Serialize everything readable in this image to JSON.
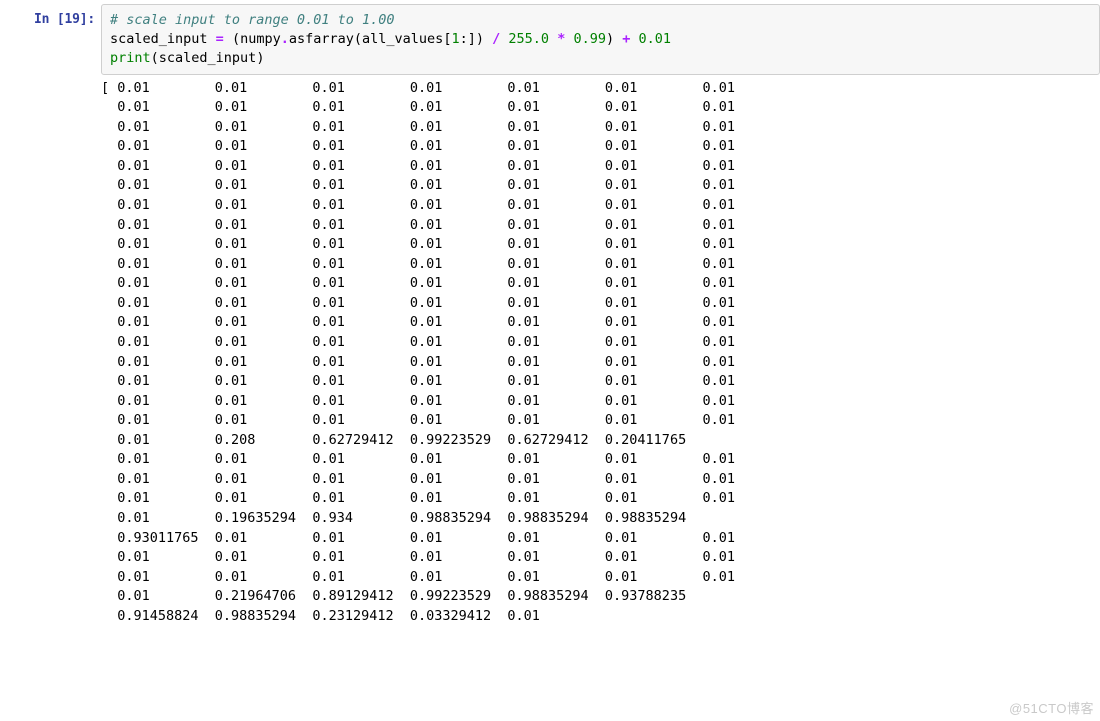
{
  "cell": {
    "execution_count": 19,
    "prompt_prefix": "In [",
    "prompt_suffix": "]:",
    "code": {
      "line1_comment": "# scale input to range 0.01 to 1.00",
      "l2_var": "scaled_input",
      "l2_eq": " = ",
      "l2_p1": "(",
      "l2_numpy": "numpy",
      "l2_dot1": ".",
      "l2_asf": "asfarray",
      "l2_p2": "(",
      "l2_allv": "all_values",
      "l2_br1": "[",
      "l2_one": "1",
      "l2_colon": ":",
      "l2_br2": "]) ",
      "l2_div": "/",
      "l2_sp1": " ",
      "l2_255": "255.0",
      "l2_sp2": " ",
      "l2_mul": "*",
      "l2_sp3": " ",
      "l2_099": "0.99",
      "l2_p3": ") ",
      "l2_plus": "+",
      "l2_sp4": " ",
      "l2_001": "0.01",
      "l3_print": "print",
      "l3_p1": "(",
      "l3_arg": "scaled_input",
      "l3_p2": ")"
    },
    "output_columns": 7,
    "output_col_width": 12,
    "output_opening": "[ ",
    "output_rows": [
      [
        "0.01",
        "0.01",
        "0.01",
        "0.01",
        "0.01",
        "0.01",
        "0.01"
      ],
      [
        "0.01",
        "0.01",
        "0.01",
        "0.01",
        "0.01",
        "0.01",
        "0.01"
      ],
      [
        "0.01",
        "0.01",
        "0.01",
        "0.01",
        "0.01",
        "0.01",
        "0.01"
      ],
      [
        "0.01",
        "0.01",
        "0.01",
        "0.01",
        "0.01",
        "0.01",
        "0.01"
      ],
      [
        "0.01",
        "0.01",
        "0.01",
        "0.01",
        "0.01",
        "0.01",
        "0.01"
      ],
      [
        "0.01",
        "0.01",
        "0.01",
        "0.01",
        "0.01",
        "0.01",
        "0.01"
      ],
      [
        "0.01",
        "0.01",
        "0.01",
        "0.01",
        "0.01",
        "0.01",
        "0.01"
      ],
      [
        "0.01",
        "0.01",
        "0.01",
        "0.01",
        "0.01",
        "0.01",
        "0.01"
      ],
      [
        "0.01",
        "0.01",
        "0.01",
        "0.01",
        "0.01",
        "0.01",
        "0.01"
      ],
      [
        "0.01",
        "0.01",
        "0.01",
        "0.01",
        "0.01",
        "0.01",
        "0.01"
      ],
      [
        "0.01",
        "0.01",
        "0.01",
        "0.01",
        "0.01",
        "0.01",
        "0.01"
      ],
      [
        "0.01",
        "0.01",
        "0.01",
        "0.01",
        "0.01",
        "0.01",
        "0.01"
      ],
      [
        "0.01",
        "0.01",
        "0.01",
        "0.01",
        "0.01",
        "0.01",
        "0.01"
      ],
      [
        "0.01",
        "0.01",
        "0.01",
        "0.01",
        "0.01",
        "0.01",
        "0.01"
      ],
      [
        "0.01",
        "0.01",
        "0.01",
        "0.01",
        "0.01",
        "0.01",
        "0.01"
      ],
      [
        "0.01",
        "0.01",
        "0.01",
        "0.01",
        "0.01",
        "0.01",
        "0.01"
      ],
      [
        "0.01",
        "0.01",
        "0.01",
        "0.01",
        "0.01",
        "0.01",
        "0.01"
      ],
      [
        "0.01",
        "0.01",
        "0.01",
        "0.01",
        "0.01",
        "0.01",
        "0.01"
      ],
      [
        "0.01",
        "0.208",
        "0.62729412",
        "0.99223529",
        "0.62729412",
        "0.20411765"
      ],
      [
        "0.01",
        "0.01",
        "0.01",
        "0.01",
        "0.01",
        "0.01",
        "0.01"
      ],
      [
        "0.01",
        "0.01",
        "0.01",
        "0.01",
        "0.01",
        "0.01",
        "0.01"
      ],
      [
        "0.01",
        "0.01",
        "0.01",
        "0.01",
        "0.01",
        "0.01",
        "0.01"
      ],
      [
        "0.01",
        "0.19635294",
        "0.934",
        "0.98835294",
        "0.98835294",
        "0.98835294"
      ],
      [
        "0.93011765",
        "0.01",
        "0.01",
        "0.01",
        "0.01",
        "0.01",
        "0.01"
      ],
      [
        "0.01",
        "0.01",
        "0.01",
        "0.01",
        "0.01",
        "0.01",
        "0.01"
      ],
      [
        "0.01",
        "0.01",
        "0.01",
        "0.01",
        "0.01",
        "0.01",
        "0.01"
      ],
      [
        "0.01",
        "0.21964706",
        "0.89129412",
        "0.99223529",
        "0.98835294",
        "0.93788235"
      ],
      [
        "0.91458824",
        "0.98835294",
        "0.23129412",
        "0.03329412",
        "0.01"
      ]
    ]
  },
  "watermark": "@51CTO博客"
}
